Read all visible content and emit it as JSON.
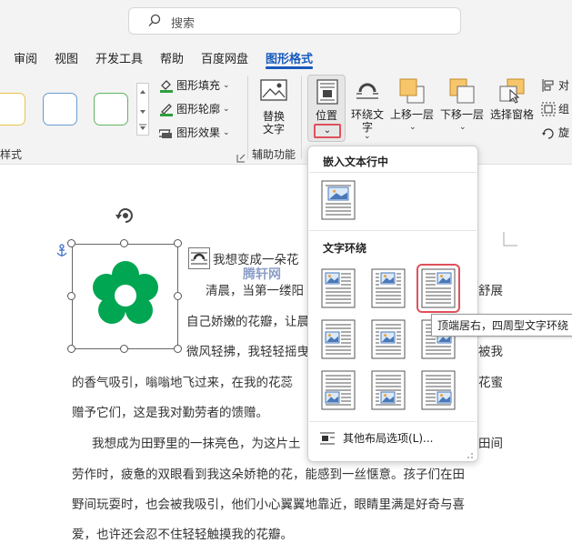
{
  "search": {
    "label": "搜索"
  },
  "tabs": [
    {
      "label": "审阅"
    },
    {
      "label": "视图"
    },
    {
      "label": "开发工具"
    },
    {
      "label": "帮助"
    },
    {
      "label": "百度网盘"
    },
    {
      "label": "图形格式"
    }
  ],
  "ribbon": {
    "fill_label": "图形填充",
    "outline_label": "图形轮廓",
    "effects_label": "图形效果",
    "styles_group": "样式",
    "replace_text": [
      "替换",
      "文字"
    ],
    "accessibility_group": "辅助功能",
    "position_label": "位置",
    "wrap_text": [
      "环绕文",
      "字"
    ],
    "bring_forward": "上移一层",
    "send_backward": "下移一层",
    "selection_pane": "选择窗格",
    "align_label": "对",
    "group_label": "组",
    "rotate_label": "旋"
  },
  "panel": {
    "inline_heading": "嵌入文本行中",
    "wrap_heading": "文字环绕",
    "more_options": "其他布局选项(L)...",
    "more_options_underline": "L",
    "selected_option": "顶端居右，四周型文字环绕"
  },
  "tooltip": "顶端居右，四周型文字环绕",
  "watermark": "腾轩网",
  "document": {
    "lines": [
      "我想变成一朵花",
      "清晨，当第一缕阳",
      "舒展",
      "自己娇嫩的花瓣，让晨",
      "微风轻拂，我轻轻摇曳",
      "被我",
      "的香气吸引，嗡嗡地飞过来，在我的花蕊",
      "花蜜",
      "赠予它们，这是我对勤劳者的馈赠。",
      "我想成为田野里的一抹亮色，为这片土",
      "田间",
      "劳作时，疲惫的双眼看到我这朵娇艳的花，能感到一丝惬意。孩子们在田",
      "野间玩耍时，也会被我吸引，他们小心翼翼地靠近，眼睛里满是好奇与喜",
      "爱，也许还会忍不住轻轻触摸我的花瓣。"
    ]
  },
  "colors": {
    "accent": "#185abd",
    "flower": "#00a651",
    "highlight": "#e0505a"
  }
}
